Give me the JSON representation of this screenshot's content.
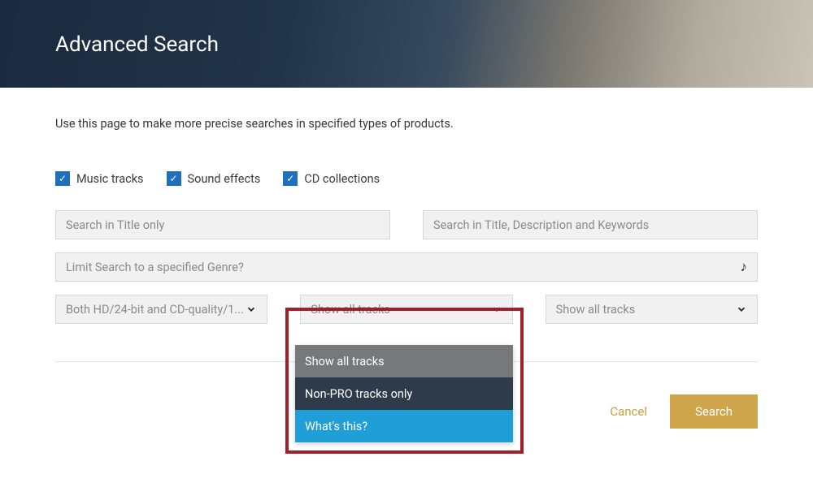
{
  "header": {
    "title": "Advanced Search"
  },
  "intro": "Use this page to make more precise searches in specified types of products.",
  "checkboxes": [
    {
      "label": "Music tracks",
      "checked": true
    },
    {
      "label": "Sound effects",
      "checked": true
    },
    {
      "label": "CD collections",
      "checked": true
    }
  ],
  "inputs": {
    "title_only": {
      "placeholder": "Search in Title only"
    },
    "all_fields": {
      "placeholder": "Search in Title, Description and Keywords"
    },
    "genre": {
      "placeholder": "Limit Search to a specified Genre?"
    }
  },
  "selects": {
    "quality": {
      "value": "Both HD/24-bit and CD-quality/1..."
    },
    "pro_middle": {
      "value": "Show all tracks"
    },
    "pro_right": {
      "value": "Show all tracks"
    }
  },
  "dropdown_options": [
    "Show all tracks",
    "Non-PRO tracks only",
    "What's this?"
  ],
  "buttons": {
    "cancel": "Cancel",
    "search": "Search"
  },
  "colors": {
    "checkbox": "#1f6fc0",
    "highlight_border": "#a01f2b",
    "accent_link": "#cc9e3f",
    "primary_button": "#cfa54c",
    "opt_selected": "#76787b",
    "opt_dark": "#2d3b4b",
    "opt_link": "#1f9ed8"
  }
}
